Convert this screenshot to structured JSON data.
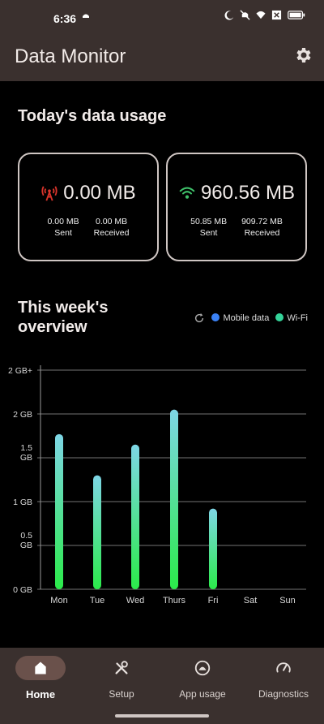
{
  "status_bar": {
    "time": "6:36"
  },
  "app_bar": {
    "title": "Data Monitor",
    "settings_icon": "gear-icon"
  },
  "today": {
    "title": "Today's data usage",
    "mobile": {
      "icon": "cell-tower-icon",
      "icon_color": "#d9342b",
      "total": "0.00 MB",
      "sent_value": "0.00 MB",
      "sent_label": "Sent",
      "received_value": "0.00 MB",
      "received_label": "Received"
    },
    "wifi": {
      "icon": "wifi-icon",
      "icon_color": "#3fc16a",
      "total": "960.56 MB",
      "sent_value": "50.85 MB",
      "sent_label": "Sent",
      "received_value": "909.72 MB",
      "received_label": "Received"
    }
  },
  "week": {
    "title_line1": "This week's",
    "title_line2": "overview",
    "legend": [
      {
        "label": "Mobile data",
        "color": "#3b82f6"
      },
      {
        "label": "Wi-Fi",
        "color": "#34d399"
      }
    ]
  },
  "chart_data": {
    "type": "bar",
    "categories": [
      "Mon",
      "Tue",
      "Wed",
      "Thurs",
      "Fri",
      "Sat",
      "Sun"
    ],
    "series": [
      {
        "name": "Mobile data",
        "values": [
          0,
          0,
          0,
          0,
          0,
          0,
          0
        ]
      },
      {
        "name": "Wi-Fi",
        "values": [
          1.77,
          1.3,
          1.65,
          2.05,
          0.92,
          0,
          0
        ]
      }
    ],
    "y_ticks": [
      {
        "value": 0,
        "label": [
          "0 GB"
        ]
      },
      {
        "value": 0.5,
        "label": [
          "0.5",
          "GB"
        ]
      },
      {
        "value": 1,
        "label": [
          "1 GB"
        ]
      },
      {
        "value": 1.5,
        "label": [
          "1.5",
          "GB"
        ]
      },
      {
        "value": 2,
        "label": [
          "2 GB"
        ]
      },
      {
        "value": 2.5,
        "label": [
          "2 GB+"
        ]
      }
    ],
    "ylim": [
      0,
      2.5
    ],
    "grid": true,
    "bar_color_top": "#7ed6e6",
    "bar_color_bottom": "#2bea4a",
    "gridline_color": "#9a9a9a",
    "tick_label_color": "#d8d8d8"
  },
  "nav": [
    {
      "label": "Home",
      "icon": "home-icon",
      "active": true
    },
    {
      "label": "Setup",
      "icon": "tools-icon",
      "active": false
    },
    {
      "label": "App usage",
      "icon": "app-usage-icon",
      "active": false
    },
    {
      "label": "Diagnostics",
      "icon": "speedometer-icon",
      "active": false
    }
  ]
}
